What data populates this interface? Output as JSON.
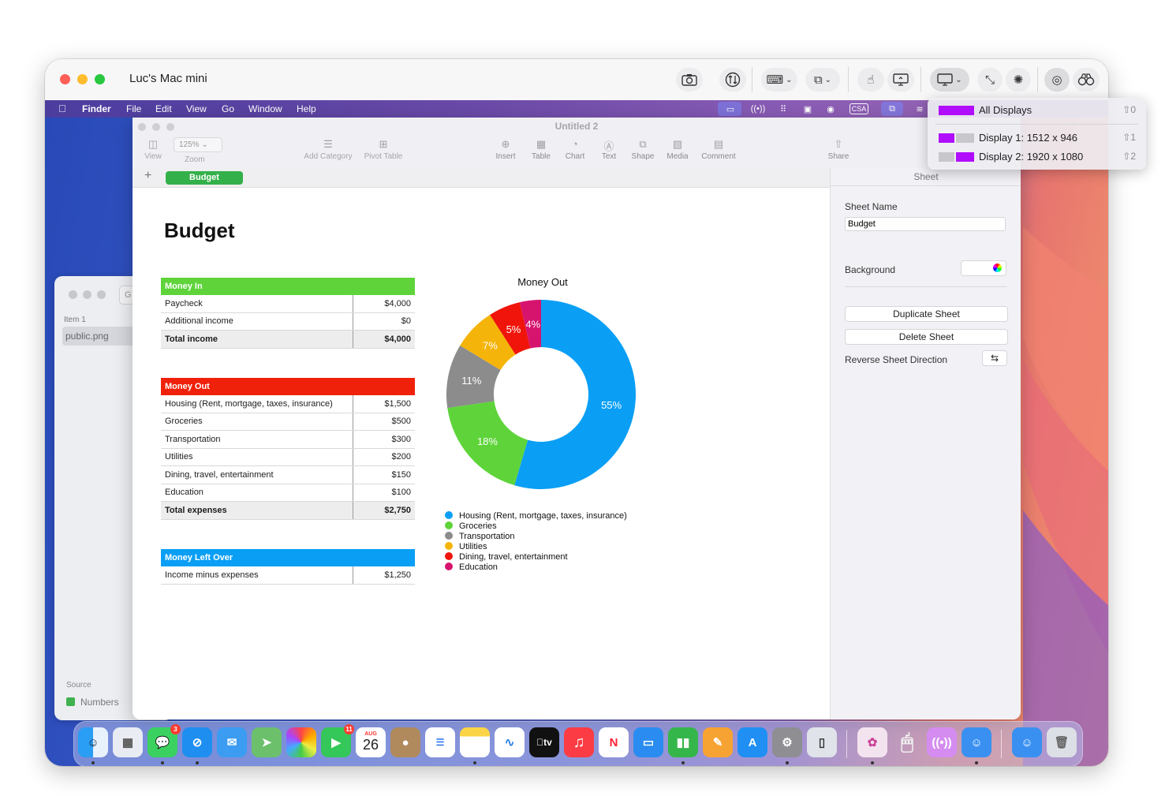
{
  "window": {
    "title": "Luc's Mac mini"
  },
  "toolbar_icons": [
    "camera-icon",
    "swap-icon",
    "keyboard-icon",
    "clipboard-icon",
    "hand-icon",
    "screen-share-icon",
    "display-icon",
    "shrink-icon",
    "sparkle-icon",
    "touch-icon",
    "binoculars-icon"
  ],
  "menubar": {
    "app": "Finder",
    "items": [
      "File",
      "Edit",
      "View",
      "Go",
      "Window",
      "Help"
    ],
    "csa": "CSA"
  },
  "finder": {
    "search_partial": "G",
    "item_header": "Item 1",
    "item": "public.png",
    "source_label": "Source",
    "source_app": "Numbers"
  },
  "numbers": {
    "doc_title": "Untitled 2",
    "zoom": "125%",
    "toolbar": {
      "view": "View",
      "zoom": "Zoom",
      "add_category": "Add Category",
      "pivot_table": "Pivot Table",
      "insert": "Insert",
      "table": "Table",
      "chart": "Chart",
      "text": "Text",
      "shape": "Shape",
      "media": "Media",
      "comment": "Comment",
      "share": "Share"
    },
    "add_sheet": "+",
    "sheet_tab": "Budget",
    "sheet_title": "Budget",
    "money_in": {
      "header": "Money In",
      "rows": [
        {
          "label": "Paycheck",
          "value": "$4,000"
        },
        {
          "label": "Additional income",
          "value": "$0"
        }
      ],
      "total": {
        "label": "Total income",
        "value": "$4,000"
      }
    },
    "money_out": {
      "header": "Money Out",
      "rows": [
        {
          "label": "Housing (Rent, mortgage, taxes, insurance)",
          "value": "$1,500"
        },
        {
          "label": "Groceries",
          "value": "$500"
        },
        {
          "label": "Transportation",
          "value": "$300"
        },
        {
          "label": "Utilities",
          "value": "$200"
        },
        {
          "label": "Dining, travel, entertainment",
          "value": "$150"
        },
        {
          "label": "Education",
          "value": "$100"
        }
      ],
      "total": {
        "label": "Total expenses",
        "value": "$2,750"
      }
    },
    "money_left": {
      "header": "Money Left Over",
      "rows": [
        {
          "label": "Income minus expenses",
          "value": "$1,250"
        }
      ]
    },
    "inspector": {
      "tab": "Sheet",
      "sheet_name_label": "Sheet Name",
      "sheet_name_value": "Budget",
      "background_label": "Background",
      "duplicate": "Duplicate Sheet",
      "delete": "Delete Sheet",
      "reverse": "Reverse Sheet Direction"
    }
  },
  "chart_data": {
    "type": "pie",
    "title": "Money Out",
    "categories": [
      "Housing (Rent, mortgage, taxes, insurance)",
      "Groceries",
      "Transportation",
      "Utilities",
      "Dining, travel, entertainment",
      "Education"
    ],
    "values": [
      1500,
      500,
      300,
      200,
      150,
      100
    ],
    "labels": [
      "55%",
      "18%",
      "11%",
      "7%",
      "5%",
      "4%"
    ],
    "colors": [
      "#0a9ff5",
      "#5ed43a",
      "#8c8c8c",
      "#f5b40a",
      "#f0140a",
      "#d6146e"
    ],
    "legend": "bottom"
  },
  "displays_popup": {
    "items": [
      {
        "label": "All Displays",
        "shortcut": "⇧0"
      },
      {
        "label": "Display 1: 1512 x 946",
        "shortcut": "⇧1"
      },
      {
        "label": "Display 2: 1920 x 1080",
        "shortcut": "⇧2"
      }
    ]
  },
  "dock": {
    "apps": [
      "finder",
      "launchpad",
      "messages",
      "safari",
      "mail",
      "maps",
      "photos",
      "facetime",
      "calendar",
      "contacts",
      "reminders",
      "notes",
      "freeform",
      "tv",
      "music",
      "news",
      "keynote",
      "numbers",
      "pages",
      "app-store",
      "system-settings",
      "iphone-mirroring",
      "preview",
      "mouse",
      "airdrop",
      "remote-desktop",
      "screen-sharing",
      "trash"
    ],
    "messages_badge": "3",
    "facetime_badge": "11",
    "calendar_month": "AUG",
    "calendar_day": "26",
    "tv_label": "tv"
  },
  "colors": {
    "money_in": "#5ed43a",
    "money_out": "#f0210a",
    "money_left": "#0a9ff5",
    "sheet_tab": "#34b04a",
    "popup_accent": "#b10dfd"
  }
}
